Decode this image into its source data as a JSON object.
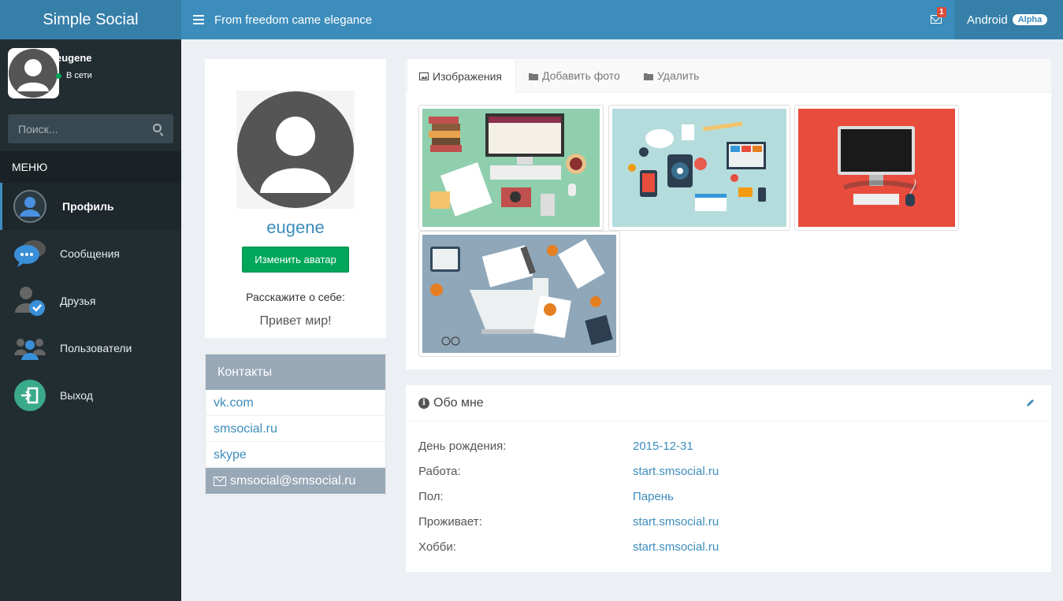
{
  "header": {
    "brand": "Simple Social",
    "tagline": "From freedom came elegance",
    "mail_count": "1",
    "user_menu": "Android",
    "user_badge": "Alpha"
  },
  "sidebar": {
    "username": "eugene",
    "status": "В сети",
    "search_placeholder": "Поиск...",
    "menu_header": "МЕНЮ",
    "items": [
      {
        "label": "Профиль",
        "icon": "profile-icon"
      },
      {
        "label": "Сообщения",
        "icon": "messages-icon"
      },
      {
        "label": "Друзья",
        "icon": "friends-icon"
      },
      {
        "label": "Пользователи",
        "icon": "users-icon"
      },
      {
        "label": "Выход",
        "icon": "logout-icon"
      }
    ]
  },
  "profile": {
    "name": "eugene",
    "change_avatar": "Изменить аватар",
    "about_label": "Расскажите о себе:",
    "about_text": "Привет мир!"
  },
  "contacts": {
    "title": "Контакты",
    "items": [
      "vk.com",
      "smsocial.ru",
      "skype"
    ],
    "email": "smsocial@smsocial.ru"
  },
  "gallery": {
    "tabs": [
      "Изображения",
      "Добавить фото",
      "Удалить"
    ],
    "images": [
      "desk-illustration",
      "tech-network-illustration",
      "monitor-illustration",
      "laptop-workspace-illustration"
    ]
  },
  "about": {
    "title": "Обо мне",
    "rows": [
      {
        "label": "День рождения:",
        "value": "2015-12-31"
      },
      {
        "label": "Работа:",
        "value": "start.smsocial.ru"
      },
      {
        "label": "Пол:",
        "value": "Парень"
      },
      {
        "label": "Проживает:",
        "value": "start.smsocial.ru"
      },
      {
        "label": "Хобби:",
        "value": "start.smsocial.ru"
      }
    ]
  },
  "colors": {
    "primary": "#3c8dbc",
    "primary_dark": "#367fa9",
    "sidebar": "#222d32",
    "success": "#00a65a",
    "contacts_header": "#98a8b7"
  }
}
